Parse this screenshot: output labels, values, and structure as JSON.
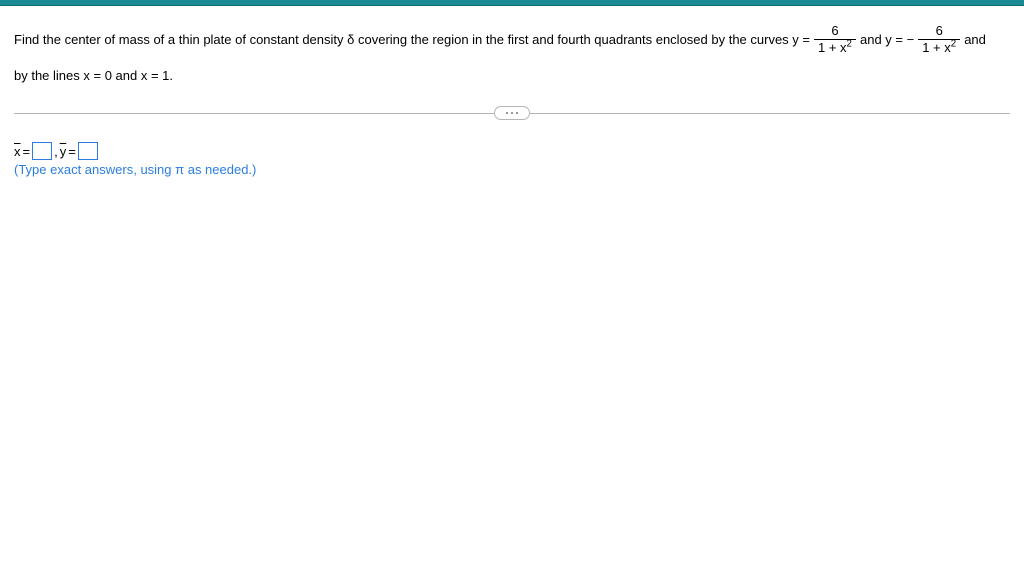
{
  "question": {
    "part1": "Find the center of mass of a thin plate of constant density δ covering the region in the first and fourth quadrants enclosed by the curves y =",
    "frac1_num": "6",
    "frac1_den_pre": "1 + x",
    "frac1_den_sup": "2",
    "mid1": " and y = −",
    "frac2_num": "6",
    "frac2_den_pre": "1 + x",
    "frac2_den_sup": "2",
    "tail": " and",
    "part2": "by the lines x = 0 and x = 1."
  },
  "answer": {
    "xbar_label": "x",
    "eq": " = ",
    "comma": ", ",
    "ybar_label": "y",
    "x_value": "",
    "y_value": ""
  },
  "hint": "(Type exact answers, using π as needed.)"
}
